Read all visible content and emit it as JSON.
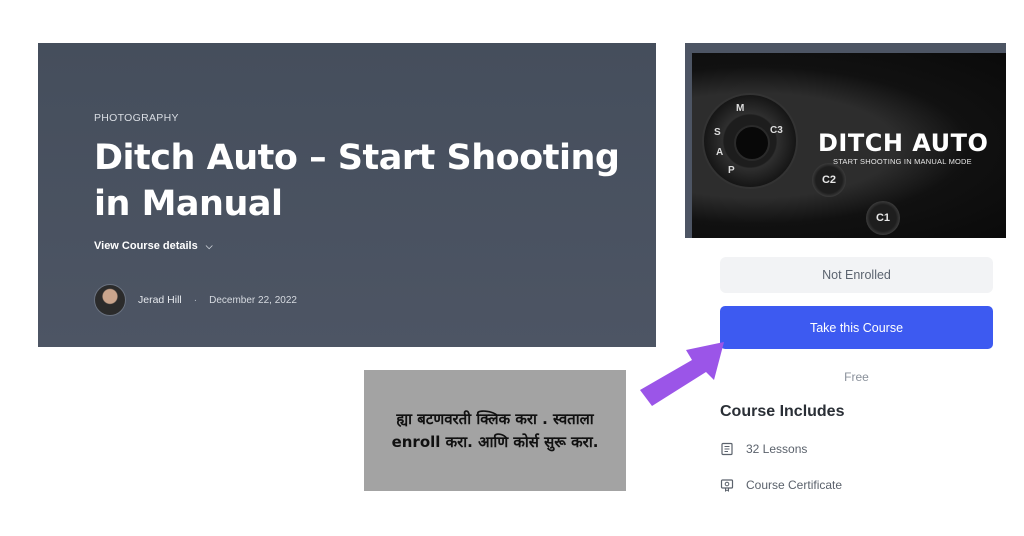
{
  "hero": {
    "category": "PHOTOGRAPHY",
    "title": "Ditch Auto – Start Shooting in Manual",
    "details_label": "View Course details",
    "author": "Jerad Hill",
    "separator": "·",
    "date": "December 22, 2022"
  },
  "card": {
    "thumbnail": {
      "title": "DITCH AUTO",
      "subtitle": "START SHOOTING IN MANUAL MODE",
      "dial_labels": [
        "M",
        "S",
        "A",
        "P",
        "C3",
        "C2",
        "C1"
      ]
    },
    "status": "Not Enrolled",
    "cta_label": "Take this Course",
    "price": "Free",
    "includes_title": "Course Includes",
    "includes": [
      {
        "icon": "book-icon",
        "label": "32 Lessons"
      },
      {
        "icon": "certificate-icon",
        "label": "Course Certificate"
      }
    ]
  },
  "annotation": {
    "text": "ह्या बटणवरती क्लिक करा . स्वताला enroll करा. आणि कोर्स सुरू करा.",
    "arrow_color": "#9b55e8"
  },
  "colors": {
    "hero_bg": "#4a5260",
    "cta_bg": "#3d5af1",
    "status_bg": "#f2f3f5",
    "note_bg": "#a3a3a3"
  }
}
